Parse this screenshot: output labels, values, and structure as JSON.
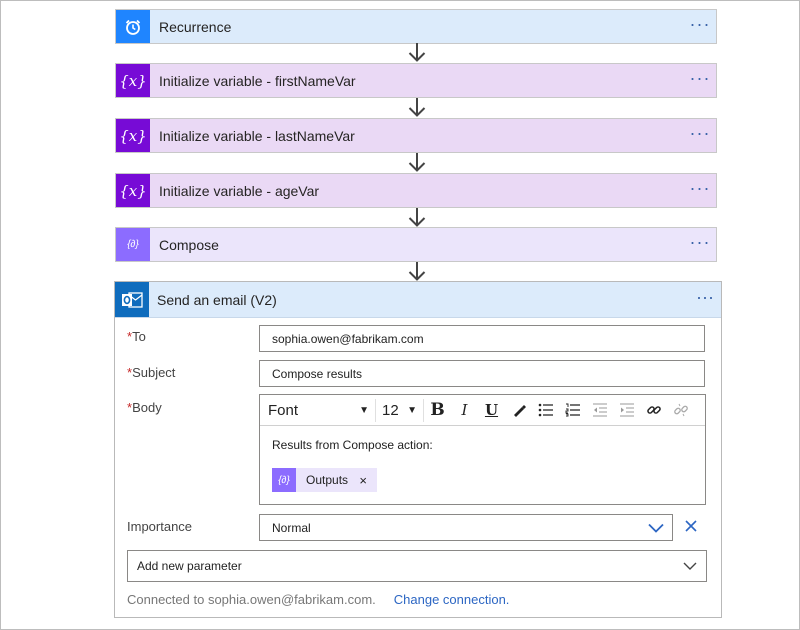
{
  "steps": [
    {
      "title": "Recurrence",
      "icon": "alarm-clock-icon",
      "color": "#1f85ff"
    },
    {
      "title": "Initialize variable - firstNameVar",
      "icon": "variable-icon",
      "color": "#770bd6"
    },
    {
      "title": "Initialize variable - lastNameVar",
      "icon": "variable-icon",
      "color": "#770bd6"
    },
    {
      "title": "Initialize variable - ageVar",
      "icon": "variable-icon",
      "color": "#770bd6"
    },
    {
      "title": "Compose",
      "icon": "compose-icon",
      "color": "#8c6cff"
    }
  ],
  "more_glyph": "···",
  "variable_glyph": "{x}",
  "compose_glyph": "{∂}",
  "email": {
    "title": "Send an email (V2)",
    "icon": "outlook-icon",
    "to_label": "To",
    "to_value": "sophia.owen@fabrikam.com",
    "subject_label": "Subject",
    "subject_value": "Compose results",
    "body_label": "Body",
    "required_mark": "*",
    "toolbar": {
      "font": "Font",
      "size": "12",
      "bold": "B",
      "italic": "I",
      "underline": "U"
    },
    "body_text": "Results from Compose action:",
    "token_label": "Outputs",
    "token_remove": "×",
    "importance_label": "Importance",
    "importance_value": "Normal",
    "add_parameter": "Add new parameter",
    "connected_text": "Connected to sophia.owen@fabrikam.com.",
    "change_connection": "Change connection."
  },
  "colors": {
    "accent": "#2c66c3",
    "required": "#c62828",
    "outlook": "#0f6cbd"
  }
}
